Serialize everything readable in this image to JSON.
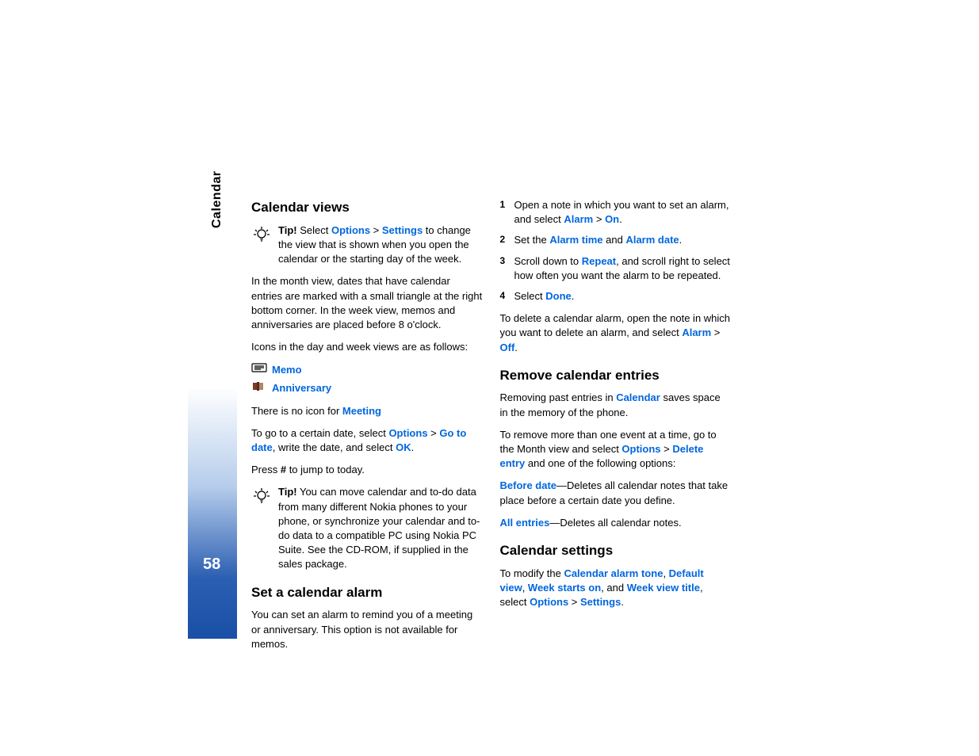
{
  "side": {
    "title": "Calendar",
    "page": "58"
  },
  "left": {
    "h1": "Calendar views",
    "tip1_label": "Tip!",
    "tip1_pre": " Select ",
    "tip1_opt": "Options",
    "tip1_gt1": " > ",
    "tip1_set": "Settings",
    "tip1_post": " to change the view that is shown when you open the calendar or the starting day of the week.",
    "p1": "In the month view, dates that have calendar entries are marked with a small triangle at the right bottom corner. In the week view, memos and anniversaries are placed before 8 o'clock.",
    "p2": "Icons in the day and week views are as follows:",
    "memo": "Memo",
    "anniv": "Anniversary",
    "noicon_pre": "There is no icon for ",
    "noicon_link": "Meeting",
    "goto_pre": "To go to a certain date, select ",
    "goto_opt": "Options",
    "goto_gt": " > ",
    "goto_link": "Go to date",
    "goto_mid": ", write the date, and select ",
    "goto_ok": "OK",
    "goto_end": ".",
    "press_pre": "Press ",
    "press_hash": "#",
    "press_post": " to jump to today.",
    "tip2_label": "Tip!",
    "tip2_text": " You can move calendar and to-do data from many different Nokia phones to your phone, or synchronize your calendar and to-do data to a compatible PC using Nokia PC Suite. See the CD-ROM, if supplied in the sales package.",
    "h2": "Set a calendar alarm",
    "p3": "You can set an alarm to remind you of a meeting or anniversary. This option is not available for memos."
  },
  "right": {
    "s1_pre": "Open a note in which you want to set an alarm, and select ",
    "s1_alarm": "Alarm",
    "s1_gt": " > ",
    "s1_on": "On",
    "s1_end": ".",
    "s2_pre": "Set the ",
    "s2_time": "Alarm time",
    "s2_and": " and ",
    "s2_date": "Alarm date",
    "s2_end": ".",
    "s3_pre": "Scroll down to ",
    "s3_repeat": "Repeat",
    "s3_post": ", and scroll right to select how often you want the alarm to be repeated.",
    "s4_pre": "Select ",
    "s4_done": "Done",
    "s4_end": ".",
    "del_pre": "To delete a calendar alarm, open the note in which you want to delete an alarm, and select ",
    "del_alarm": "Alarm",
    "del_gt": " > ",
    "del_off": "Off",
    "del_end": ".",
    "h3": "Remove calendar entries",
    "rem_pre": "Removing past entries in ",
    "rem_cal": "Calendar",
    "rem_post": " saves space in the memory of the phone.",
    "more_pre": "To remove more than one event at a time, go to the Month view and select ",
    "more_opt": "Options",
    "more_gt": " > ",
    "more_del": "Delete entry",
    "more_post": " and one of the following options:",
    "bd_label": "Before date",
    "bd_text": "—Deletes all calendar notes that take place before a certain date you define.",
    "ae_label": "All entries",
    "ae_text": "—Deletes all calendar notes.",
    "h4": "Calendar settings",
    "cs_pre": "To modify the ",
    "cs_tone": "Calendar alarm tone",
    "cs_c1": ", ",
    "cs_view": "Default view",
    "cs_c2": ", ",
    "cs_week": "Week starts on",
    "cs_c3": ", and ",
    "cs_title": "Week view title",
    "cs_mid": ", select ",
    "cs_opt": "Options",
    "cs_gt": " > ",
    "cs_set": "Settings",
    "cs_end": "."
  }
}
